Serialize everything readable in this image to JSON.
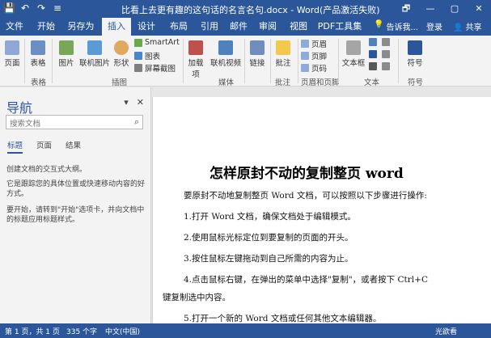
{
  "window": {
    "title": "比看上去更有趣的这句话的名言名句.docx - Word(产品激活失败)",
    "controls": [
      "🗗",
      "—",
      "▢",
      "✕"
    ]
  },
  "quick_access": [
    "💾",
    "↶",
    "↷",
    "≡"
  ],
  "tabs": [
    "文件",
    "开始",
    "另存为",
    "插入",
    "设计",
    "布局",
    "引用",
    "邮件",
    "审阅",
    "视图",
    "PDF工具集"
  ],
  "tellme": {
    "icon": "💡",
    "label": "告诉我..."
  },
  "login": "登录",
  "share": "共享",
  "ribbon": {
    "buttons": [
      "页面",
      "表格",
      "图片",
      "联机图片",
      "形状",
      "加载项",
      "联机视频",
      "链接",
      "批注",
      "页眉",
      "页脚",
      "页码",
      "文本框",
      "符号"
    ],
    "small": [
      "SmartArt",
      "图表",
      "屏幕截图"
    ],
    "groups": [
      "表格",
      "插图",
      "媒体",
      "批注",
      "页眉和页脚",
      "文本",
      "符号"
    ]
  },
  "nav": {
    "title": "导航",
    "search_placeholder": "搜索文档",
    "tabs": [
      "标题",
      "页面",
      "结果"
    ],
    "text": [
      "创建文档的交互式大纲。",
      "它是跟踪您的具体位置或快速移动内容的好方式。",
      "要开始，请转到\"开始\"选项卡，并向文档中的标题应用标题样式。"
    ]
  },
  "document": {
    "heading": "怎样原封不动的复制整页 word",
    "paragraphs": [
      "要原封不动地复制整页 Word 文档，可以按照以下步骤进行操作:",
      "1.打开 Word 文档，确保文档处于编辑模式。",
      "2.使用鼠标光标定位到要复制的页面的开头。",
      "3.按住鼠标左键拖动到自己所需的内容为止。",
      "4.点击鼠标右键，在弹出的菜单中选择\"复制\"，或者按下 Ctrl+C",
      "键复制选中内容。",
      "5.打开一个新的 Word 文档或任何其他文本编辑器。"
    ]
  },
  "status": {
    "page": "第 1 页，共 1 页",
    "words": "335 个字",
    "lang": "中文(中国)",
    "watermark": "光欲看"
  }
}
